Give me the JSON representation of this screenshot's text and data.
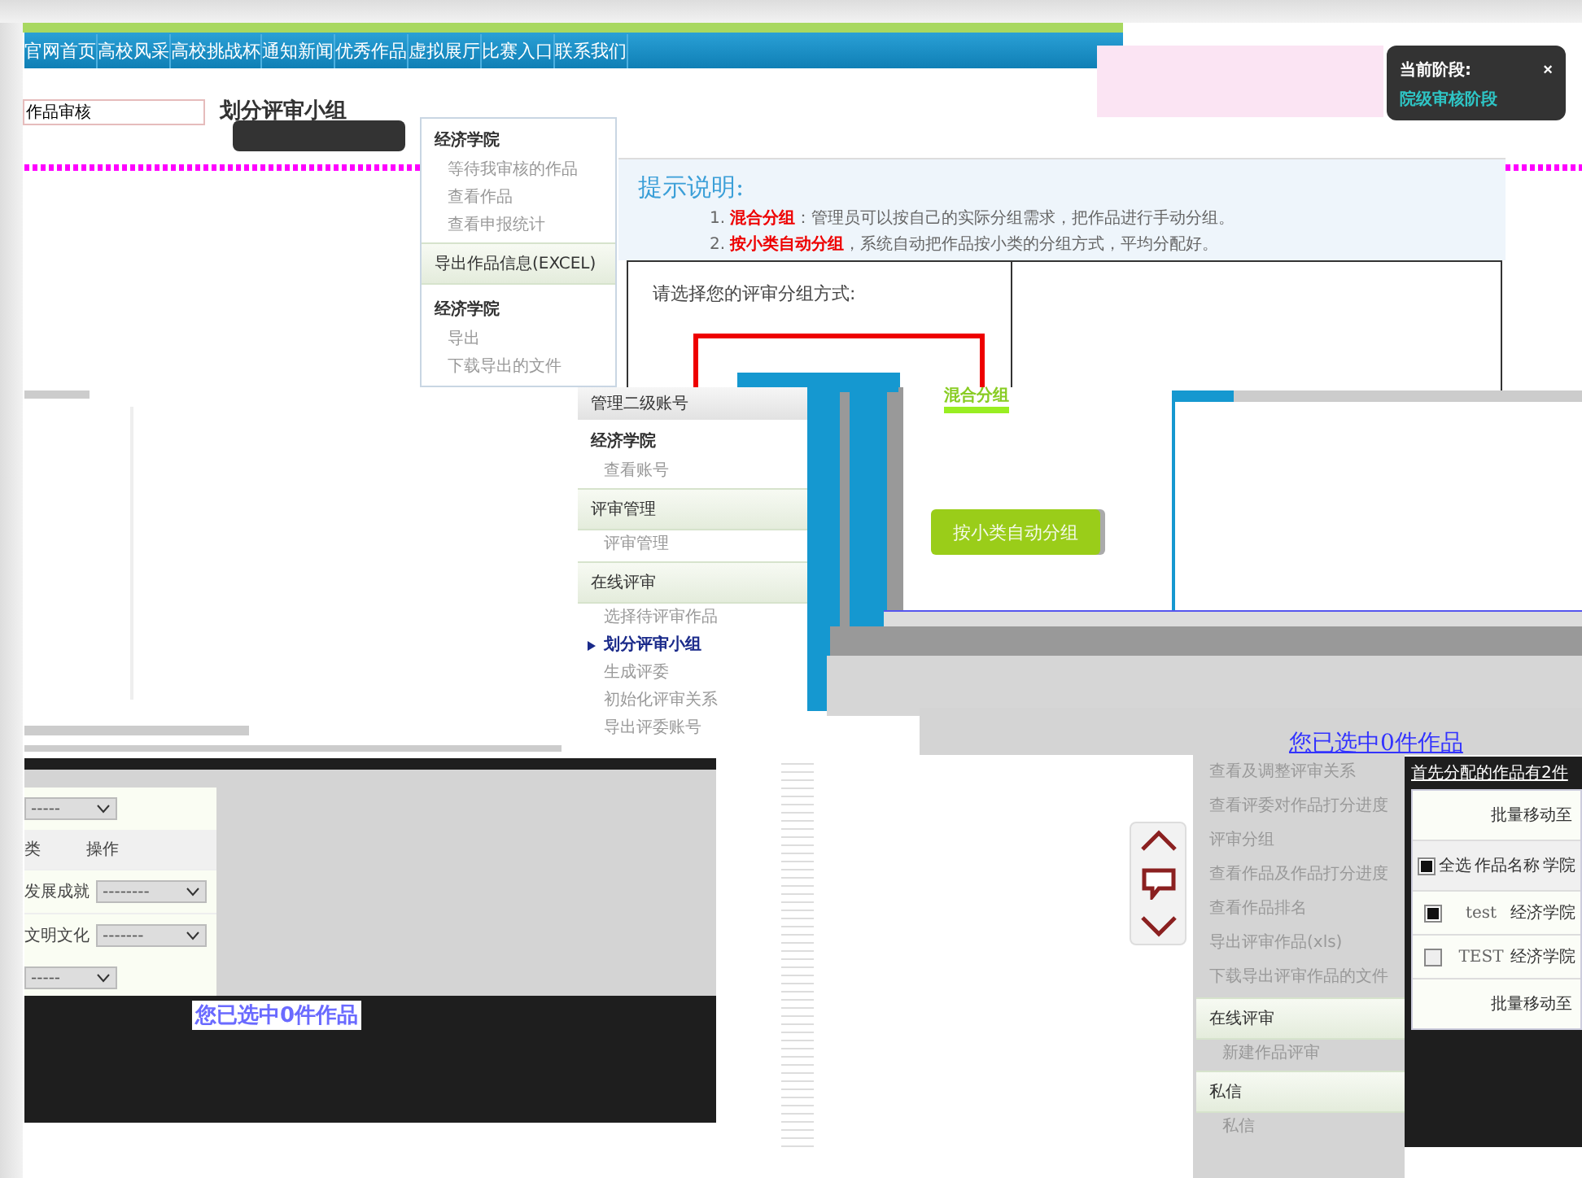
{
  "nav": {
    "items": [
      {
        "label": "官网首页"
      },
      {
        "label": "高校风采"
      },
      {
        "label": "高校挑战杯"
      },
      {
        "label": "通知新闻"
      },
      {
        "label": "优秀作品"
      },
      {
        "label": "虚拟展厅"
      },
      {
        "label": "比赛入口"
      },
      {
        "label": "联系我们"
      }
    ]
  },
  "search": {
    "value": "作品审核"
  },
  "page_title": "划分评审小组",
  "stage_popup": {
    "label": "当前阶段:",
    "close": "×",
    "stage": "院级审核阶段"
  },
  "menus": [
    {
      "sections": [
        {
          "title": "经济学院",
          "kind": "college",
          "items": [
            {
              "label": "等待我审核的作品",
              "selected": false
            },
            {
              "label": "查看作品",
              "selected": false
            },
            {
              "label": "查看申报统计",
              "selected": false
            }
          ]
        },
        {
          "title": "导出作品信息(EXCEL)",
          "kind": "group"
        },
        {
          "title": "经济学院",
          "kind": "college",
          "items": [
            {
              "label": "导出",
              "selected": false
            },
            {
              "label": "下载导出的文件",
              "selected": false
            }
          ]
        }
      ]
    },
    {
      "title": "管理二级账号",
      "sections": [
        {
          "title": "经济学院",
          "kind": "college",
          "items": [
            {
              "label": "查看账号",
              "selected": false
            }
          ]
        },
        {
          "title": "评审管理",
          "kind": "group",
          "items": [
            {
              "label": "评审管理",
              "selected": false
            }
          ]
        },
        {
          "title": "在线评审",
          "kind": "group",
          "items": [
            {
              "label": "选择待评审作品",
              "selected": false
            },
            {
              "label": "划分评审小组",
              "selected": true
            },
            {
              "label": "生成评委",
              "selected": false
            },
            {
              "label": "初始化评审关系",
              "selected": false
            },
            {
              "label": "导出评委账号",
              "selected": false
            }
          ]
        }
      ]
    },
    {
      "sections": [
        {
          "kind": "plain",
          "items": [
            {
              "label": "查看及调整评审关系",
              "selected": false
            },
            {
              "label": "查看评委对作品打分进度",
              "selected": false
            },
            {
              "label": "评审分组",
              "selected": false
            },
            {
              "label": "查看作品及作品打分进度",
              "selected": false
            },
            {
              "label": "查看作品排名",
              "selected": false
            },
            {
              "label": "导出评审作品(xls)",
              "selected": false
            },
            {
              "label": "下载导出评审作品的文件",
              "selected": false
            }
          ]
        },
        {
          "title": "在线评审",
          "kind": "group",
          "items": [
            {
              "label": "新建作品评审",
              "selected": false
            }
          ]
        },
        {
          "title": "私信",
          "kind": "group",
          "items": [
            {
              "label": "私信",
              "selected": false
            }
          ]
        }
      ]
    }
  ],
  "notice": {
    "title": "提示说明:",
    "items": [
      {
        "number": "1.",
        "term": "混合分组",
        "text": "：管理员可以按自己的实际分组需求，把作品进行手动分组。"
      },
      {
        "number": "2.",
        "term": "按小类自动分组",
        "text": "，系统自动把作品按小类的分组方式，平均分配好。"
      }
    ]
  },
  "group_choice": {
    "prompt": "请选择您的评审分组方式:",
    "options": [
      {
        "label": "混合分组",
        "kind": "link"
      },
      {
        "label": "按小类自动分组",
        "kind": "button"
      }
    ]
  },
  "category_table": {
    "filter_top": "-----",
    "columns": [
      "类",
      "操作"
    ],
    "rows": [
      {
        "name": "发展成就",
        "select": "--------"
      },
      {
        "name": "文明文化",
        "select": "-------"
      }
    ],
    "filter_bottom": "-----"
  },
  "selection_notes": [
    "您已选中0件作品",
    "您已选中0件作品"
  ],
  "works_panel": {
    "heading": "首先分配的作品有2件",
    "batch_top": "批量移动至",
    "select_all": {
      "label": "全选",
      "checked": true
    },
    "columns": [
      "作品名称",
      "学院"
    ],
    "rows": [
      {
        "name": "test",
        "college": "经济学院",
        "checked": true
      },
      {
        "name": "TEST",
        "college": "经济学院",
        "checked": false
      }
    ],
    "batch_bottom": "批量移动至"
  }
}
